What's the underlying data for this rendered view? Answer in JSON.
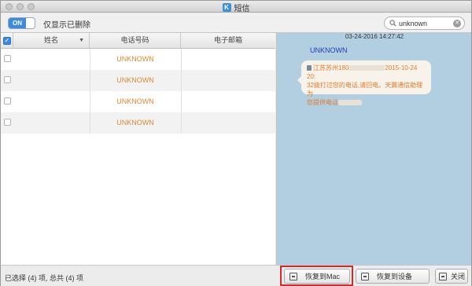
{
  "window": {
    "title": "短信",
    "app_icon_letter": "K"
  },
  "toolbar": {
    "toggle_label": "ON",
    "filter_label": "仅显示已删除",
    "search_value": "unknown"
  },
  "table": {
    "headers": {
      "name": "姓名",
      "phone": "电话号码",
      "email": "电子邮箱"
    },
    "rows": [
      {
        "name": "",
        "phone": "UNKNOWN",
        "email": ""
      },
      {
        "name": "",
        "phone": "UNKNOWN",
        "email": ""
      },
      {
        "name": "",
        "phone": "UNKNOWN",
        "email": ""
      },
      {
        "name": "",
        "phone": "UNKNOWN",
        "email": ""
      }
    ]
  },
  "message": {
    "date": "03-24-2016 14:27:42",
    "sender": "UNKNOWN",
    "text_part1": "江苏苏州180",
    "text_part2": "2015-10-24 20:",
    "text_part3": "32拨打过您的电话,请回电。天翼通信助理为",
    "text_part4": "您提供电话"
  },
  "status": {
    "summary": "已选择 (4) 项, 总共 (4) 项"
  },
  "buttons": {
    "restore_mac": "恢复到Mac",
    "restore_device": "恢复到设备",
    "close": "关闭"
  }
}
